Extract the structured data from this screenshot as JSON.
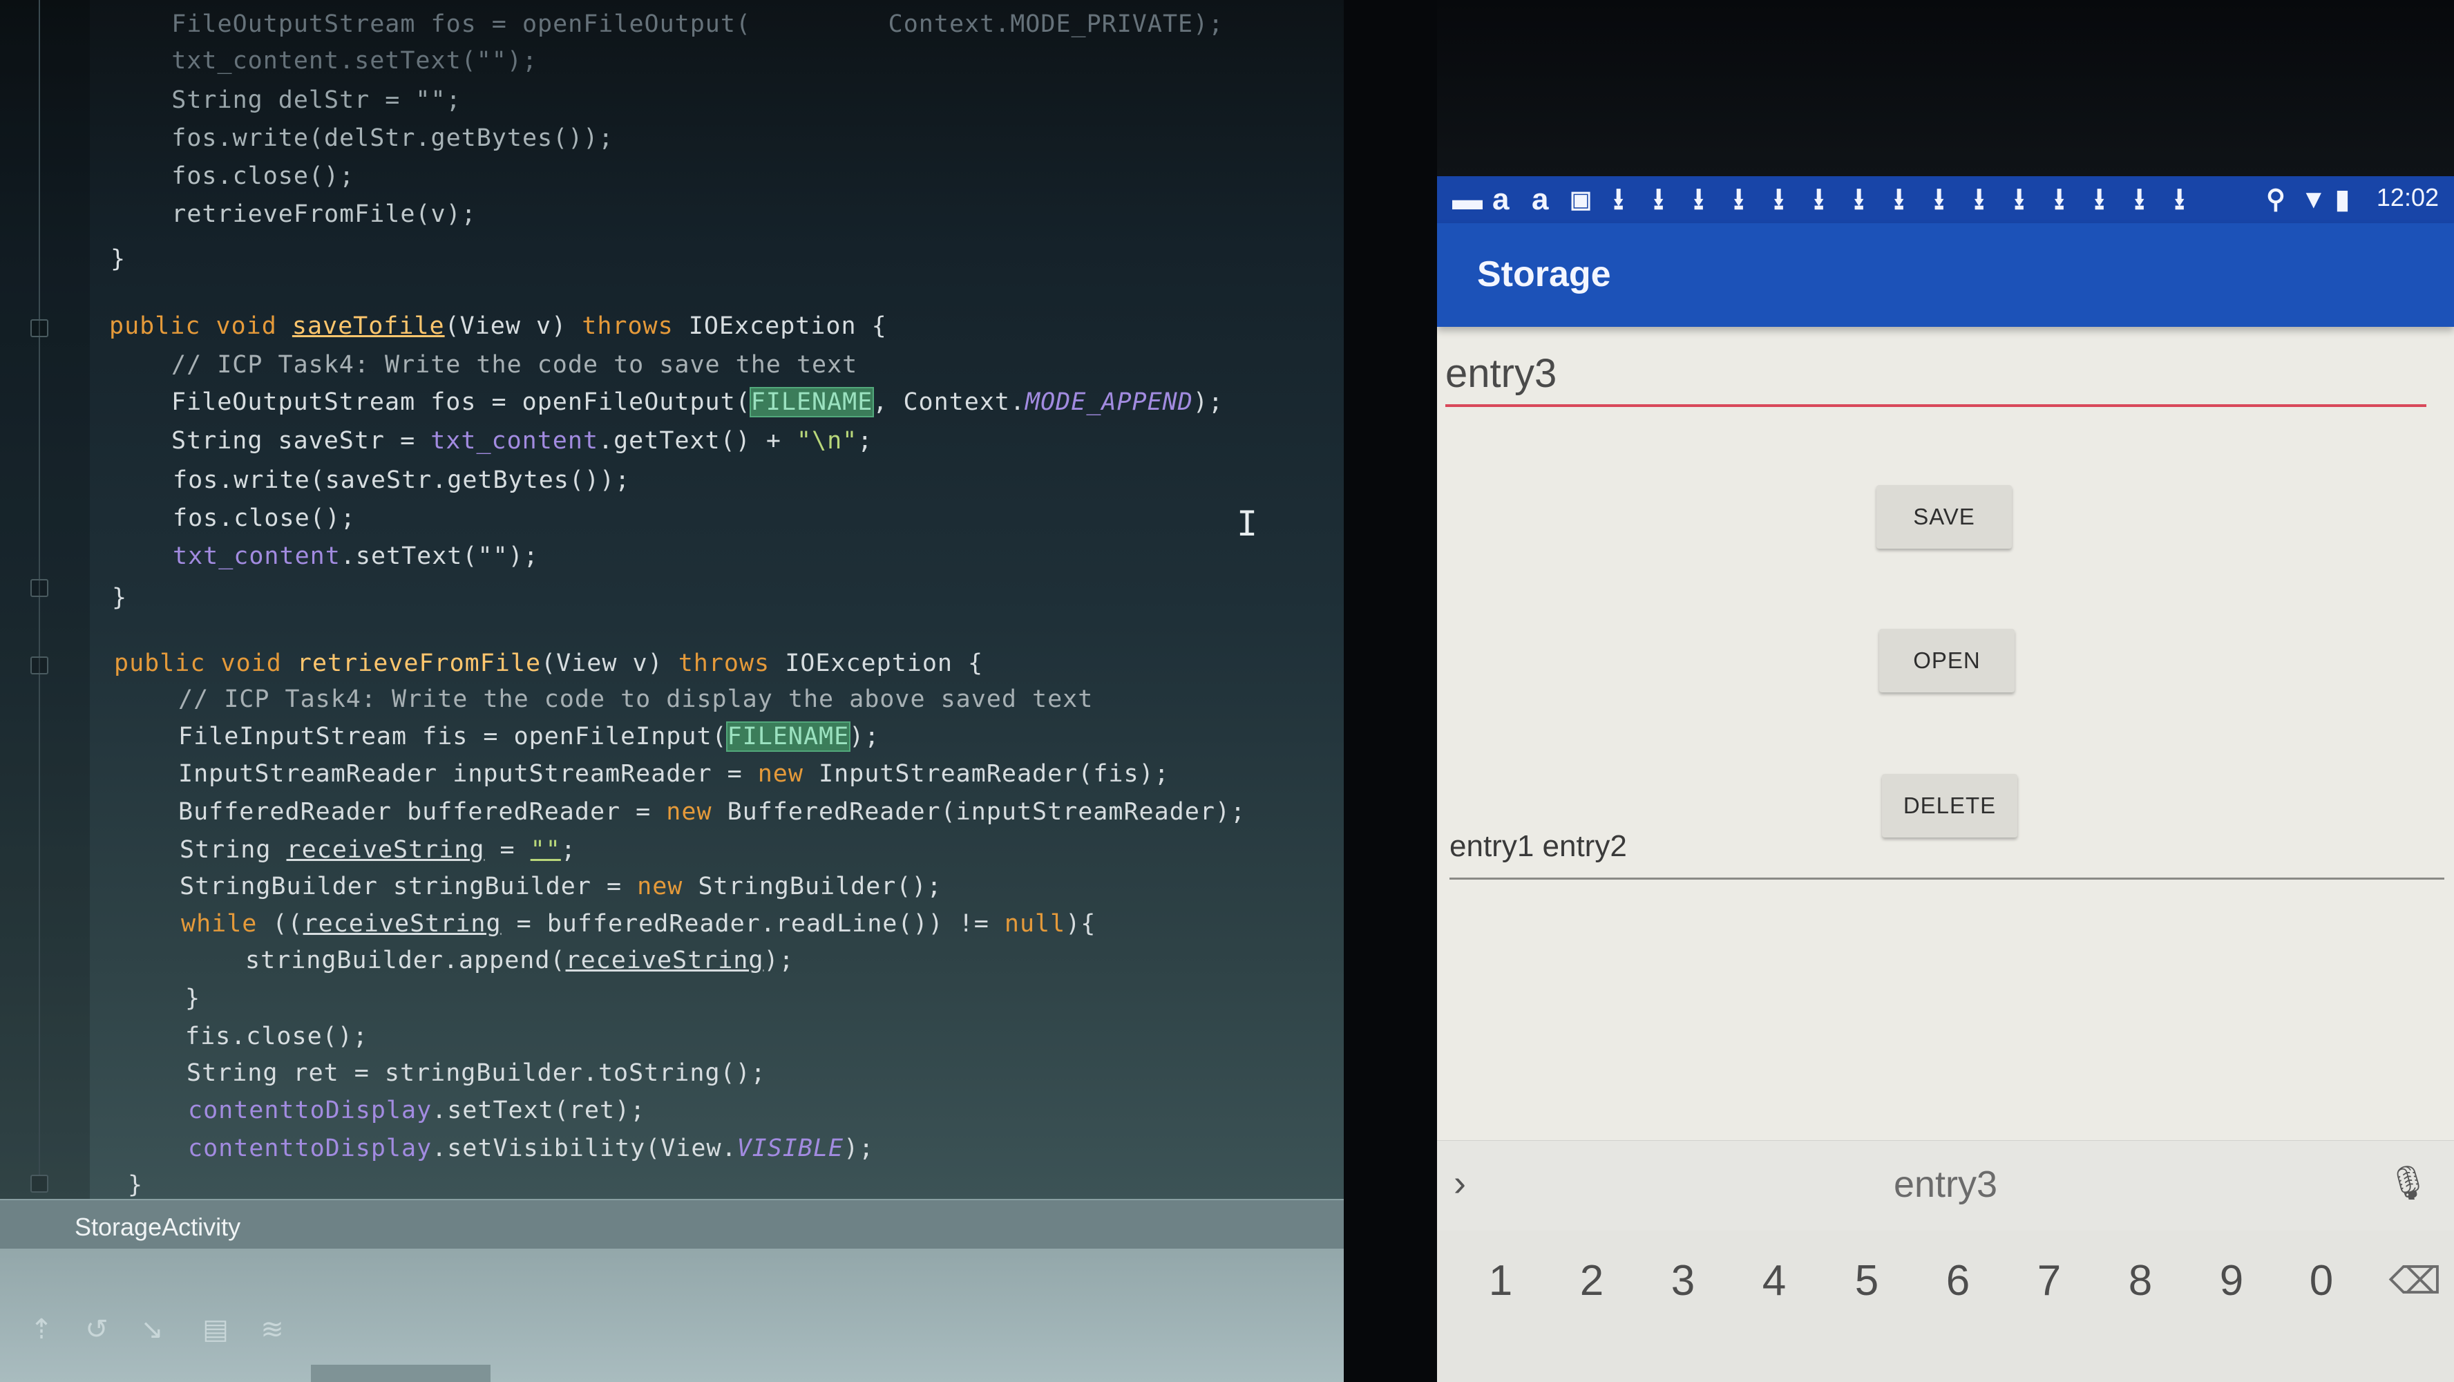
{
  "ide": {
    "code_lines": [
      {
        "text": "    FileOutputStream fos = openFileOutput(         Context.MODE_PRIVATE);"
      },
      {
        "text": "    txt_content.setText(\"\");"
      },
      {
        "text": "    String delStr = \"\";"
      },
      {
        "text": "    fos.write(delStr.getBytes());"
      },
      {
        "text": "    fos.close();"
      },
      {
        "text": "    retrieveFromFile(v);"
      },
      {
        "text": "}"
      }
    ],
    "save_method": {
      "signature_kw1": "public void ",
      "signature_name": "saveTofile",
      "signature_rest": "(View v) ",
      "signature_throws": "throws",
      "signature_exc": " IOException {",
      "comment": "// ICP Task4: Write the code to save the text",
      "fos_prefix": "FileOutputStream fos = openFileOutput(",
      "filename": "FILENAME",
      "fos_mid": ", Context.",
      "mode": "MODE_APPEND",
      "fos_end": ");",
      "save_str_prefix": "String saveStr = ",
      "save_str_field": "txt_content",
      "save_str_mid": ".getText() + ",
      "save_str_lit": "\"\\n\"",
      "save_str_end": ";",
      "write": "fos.write(saveStr.getBytes());",
      "close": "fos.close();",
      "settext_field": "txt_content",
      "settext_rest": ".setText(\"\");",
      "close_brace": "}"
    },
    "retrieve_method": {
      "signature_kw1": "public void ",
      "signature_name": "retrieveFromFile",
      "signature_rest": "(View v) ",
      "signature_throws": "throws",
      "signature_exc": " IOException {",
      "comment": "// ICP Task4: Write the code to display the above saved text",
      "fis_prefix": "FileInputStream fis = openFileInput(",
      "filename": "FILENAME",
      "fis_end": ");",
      "isr_prefix": "InputStreamReader inputStreamReader = ",
      "new_kw": "new",
      "isr_end": " InputStreamReader(fis);",
      "br_prefix": "BufferedReader bufferedReader = ",
      "br_end": " BufferedReader(inputStreamReader);",
      "rs_prefix": "String ",
      "rs_var": "receiveString",
      "rs_mid": " = ",
      "rs_lit": "\"\"",
      "rs_end": ";",
      "sb_prefix": "StringBuilder stringBuilder = ",
      "sb_end": " StringBuilder();",
      "while_kw": "while",
      "while_mid1": " ((",
      "while_var": "receiveString",
      "while_mid2": " = bufferedReader.readLine()) != ",
      "null_kw": "null",
      "while_end": "){",
      "append_prefix": "stringBuilder.append(",
      "append_var": "receiveString",
      "append_end": ");",
      "inner_brace": "}",
      "fis_close": "fis.close();",
      "ret": "String ret = stringBuilder.toString();",
      "ctd1_field": "contenttoDisplay",
      "ctd1_rest": ".setText(ret);",
      "ctd2_field": "contenttoDisplay",
      "ctd2_mid": ".setVisibility(View.",
      "ctd2_const": "VISIBLE",
      "ctd2_end": ");",
      "close_brace": "}"
    },
    "status_label": "StorageActivity"
  },
  "phone": {
    "status_time": "12:02",
    "app_title": "Storage",
    "input_value": "entry3",
    "buttons": {
      "save": "SAVE",
      "open": "OPEN",
      "delete": "DELETE"
    },
    "display_text": "entry1 entry2",
    "keyboard": {
      "suggestion": "entry3",
      "keys": [
        "1",
        "2",
        "3",
        "4",
        "5",
        "6",
        "7",
        "8",
        "9",
        "0"
      ]
    }
  },
  "colors": {
    "app_bar": "#1c52b8",
    "status_bar": "#1845a8",
    "input_underline": "#d9485a",
    "ide_keyword": "#e59a3a",
    "ide_method": "#ffc66d",
    "ide_highlight": "#3b7d5a"
  },
  "icons": {
    "statusbar_left": [
      "message-icon",
      "amazon-icon",
      "amazon-icon",
      "gallery-icon",
      "download-icon"
    ],
    "statusbar_right": [
      "location-icon",
      "wifi-icon",
      "battery-icon"
    ],
    "keyboard": [
      "chevron-right-icon",
      "mic-icon",
      "backspace-icon"
    ]
  }
}
